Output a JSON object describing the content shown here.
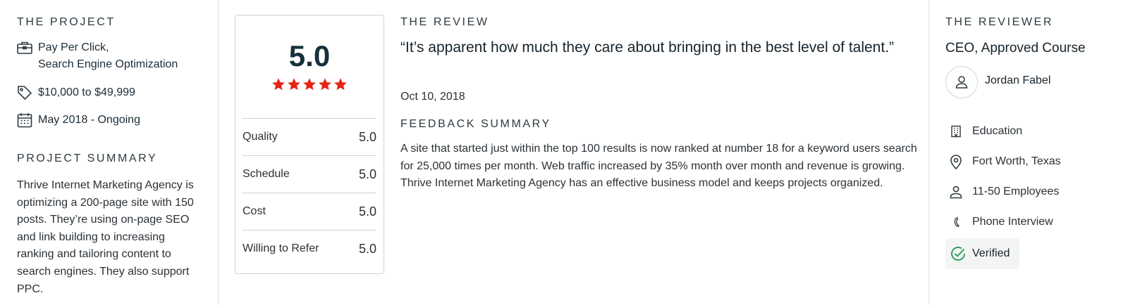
{
  "project": {
    "heading": "THE PROJECT",
    "services_line1": "Pay Per Click,",
    "services_line2": "Search Engine Optimization",
    "budget": "$10,000 to $49,999",
    "timeline": "May 2018 - Ongoing",
    "summary_heading": "PROJECT SUMMARY",
    "summary": "Thrive Internet Marketing Agency is optimizing a 200-page site with 150 posts. They’re using on-page SEO and link building to increasing ranking and tailoring content to search engines. They also support PPC."
  },
  "rating": {
    "overall": "5.0",
    "stars": 5,
    "star_color": "#e62415",
    "rows": [
      {
        "label": "Quality",
        "value": "5.0"
      },
      {
        "label": "Schedule",
        "value": "5.0"
      },
      {
        "label": "Cost",
        "value": "5.0"
      },
      {
        "label": "Willing to Refer",
        "value": "5.0"
      }
    ]
  },
  "review": {
    "heading": "THE REVIEW",
    "quote": "“It’s apparent how much they care about bringing in the best level of talent.”",
    "date": "Oct 10, 2018",
    "feedback_heading": "FEEDBACK SUMMARY",
    "feedback": "A site that started just within the top 100 results is now ranked at number 18 for a keyword users search for 25,000 times per month. Web traffic increased by 35% month over month and revenue is growing. Thrive Internet Marketing Agency has an effective business model and keeps projects organized."
  },
  "reviewer": {
    "heading": "THE REVIEWER",
    "title": "CEO, Approved Course",
    "name": "Jordan Fabel",
    "industry": "Education",
    "location": "Fort Worth, Texas",
    "size": "11-50 Employees",
    "review_type": "Phone Interview",
    "verified_label": "Verified",
    "verified_color": "#1f9b53"
  }
}
